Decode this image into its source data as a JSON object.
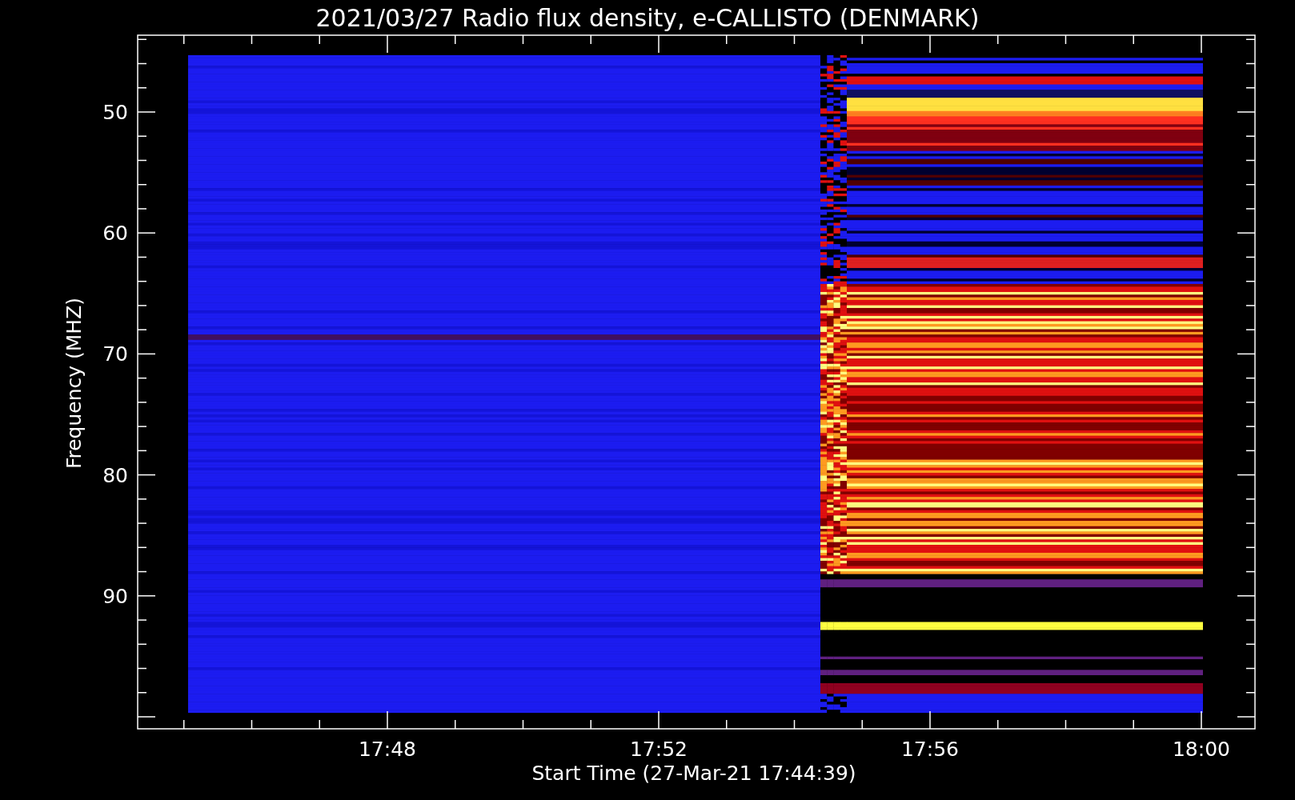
{
  "title": "2021/03/27  Radio flux density, e-CALLISTO (DENMARK)",
  "y_axis": {
    "label": "Frequency (MHZ)",
    "ticks": [
      "50",
      "60",
      "70",
      "80",
      "90"
    ]
  },
  "x_axis": {
    "label": "Start Time (27-Mar-21 17:44:39)",
    "ticks": [
      "17:48",
      "17:52",
      "17:56",
      "18:00"
    ]
  }
}
